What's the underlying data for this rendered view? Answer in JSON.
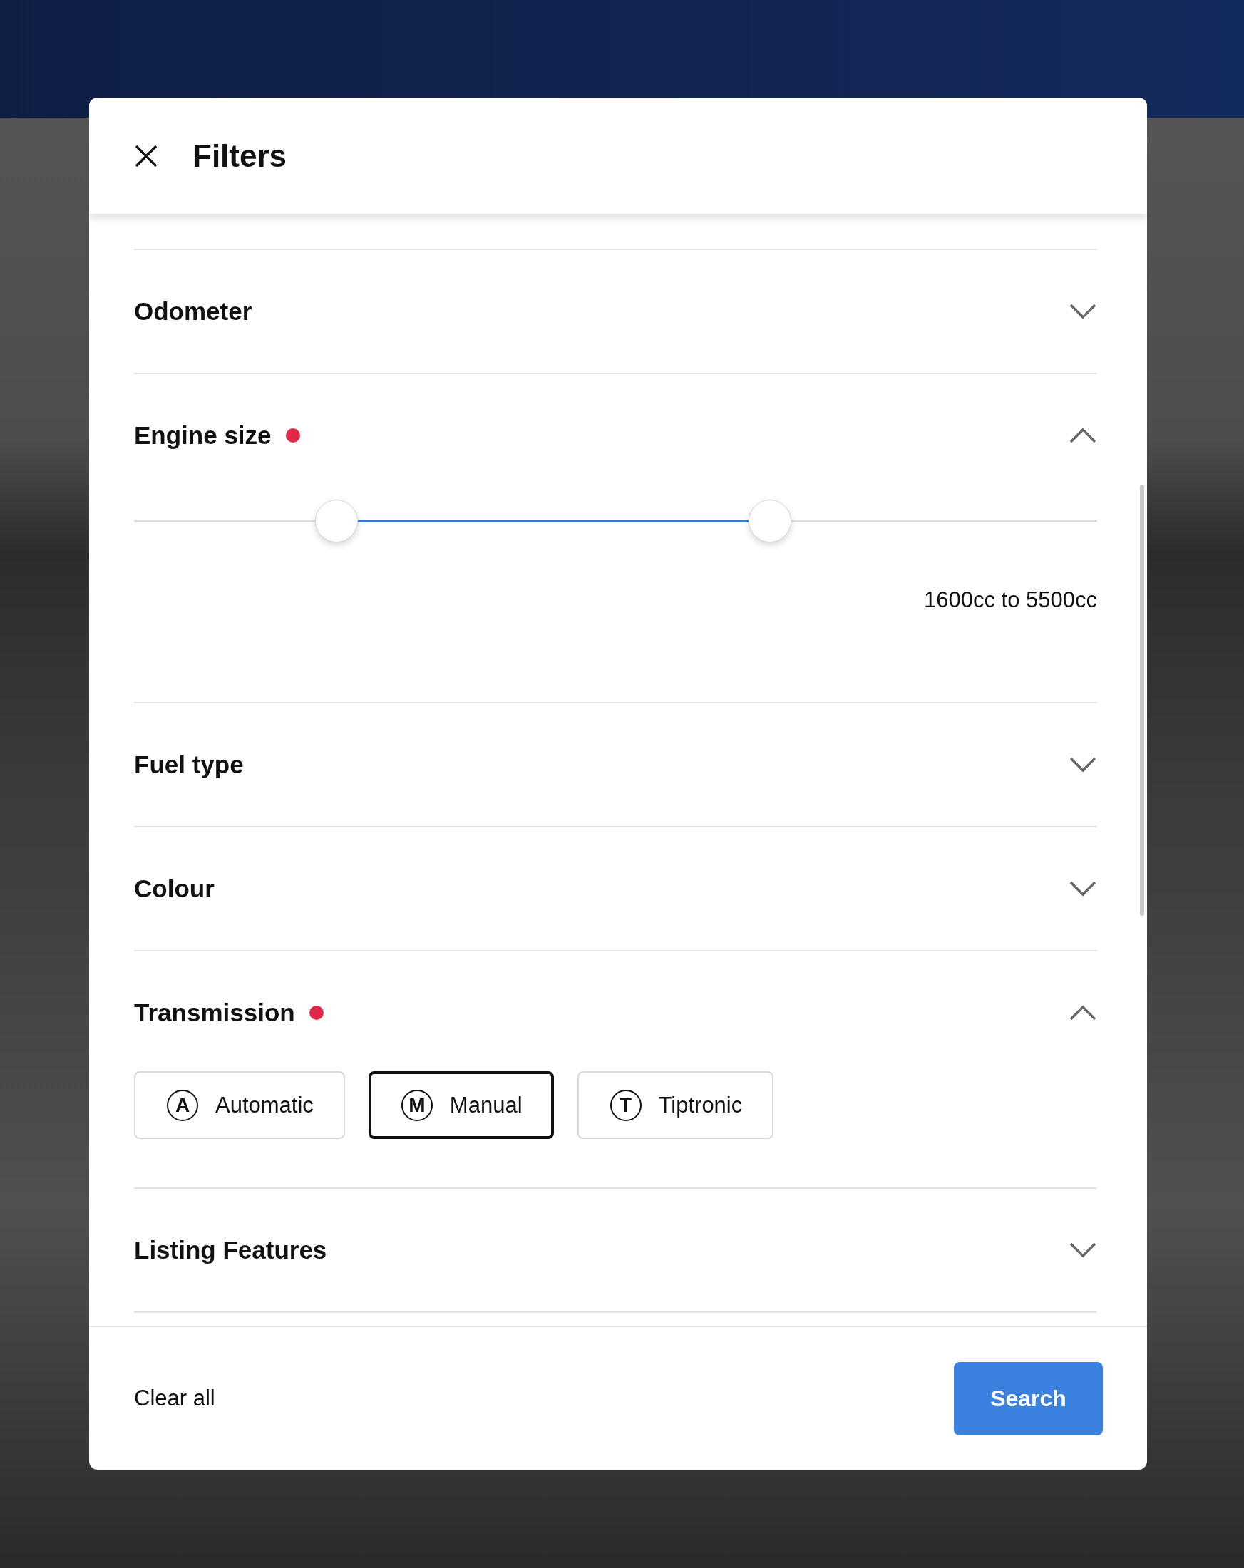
{
  "dialog": {
    "title": "Filters"
  },
  "sections": [
    {
      "kind": "collapsed",
      "title": "Odometer",
      "active": false,
      "expanded": false
    },
    {
      "kind": "range",
      "title": "Engine size",
      "active": true,
      "expanded": true,
      "thumbs": [
        {
          "level": 0.21
        },
        {
          "level": 0.66
        }
      ],
      "reading": "1600cc to 5500cc"
    },
    {
      "kind": "collapsed",
      "title": "Fuel type",
      "active": false,
      "expanded": false
    },
    {
      "kind": "collapsed",
      "title": "Colour",
      "active": false,
      "expanded": false
    },
    {
      "kind": "options",
      "title": "Transmission",
      "active": true,
      "expanded": true,
      "options": [
        {
          "badge": "A",
          "label": "Automatic",
          "selected": false
        },
        {
          "badge": "M",
          "label": "Manual",
          "selected": true
        },
        {
          "badge": "T",
          "label": "Tiptronic",
          "selected": false
        }
      ]
    },
    {
      "kind": "collapsed",
      "title": "Listing Features",
      "active": false,
      "expanded": false
    }
  ],
  "footer": {
    "clear": "Clear all",
    "submit": "Search"
  }
}
